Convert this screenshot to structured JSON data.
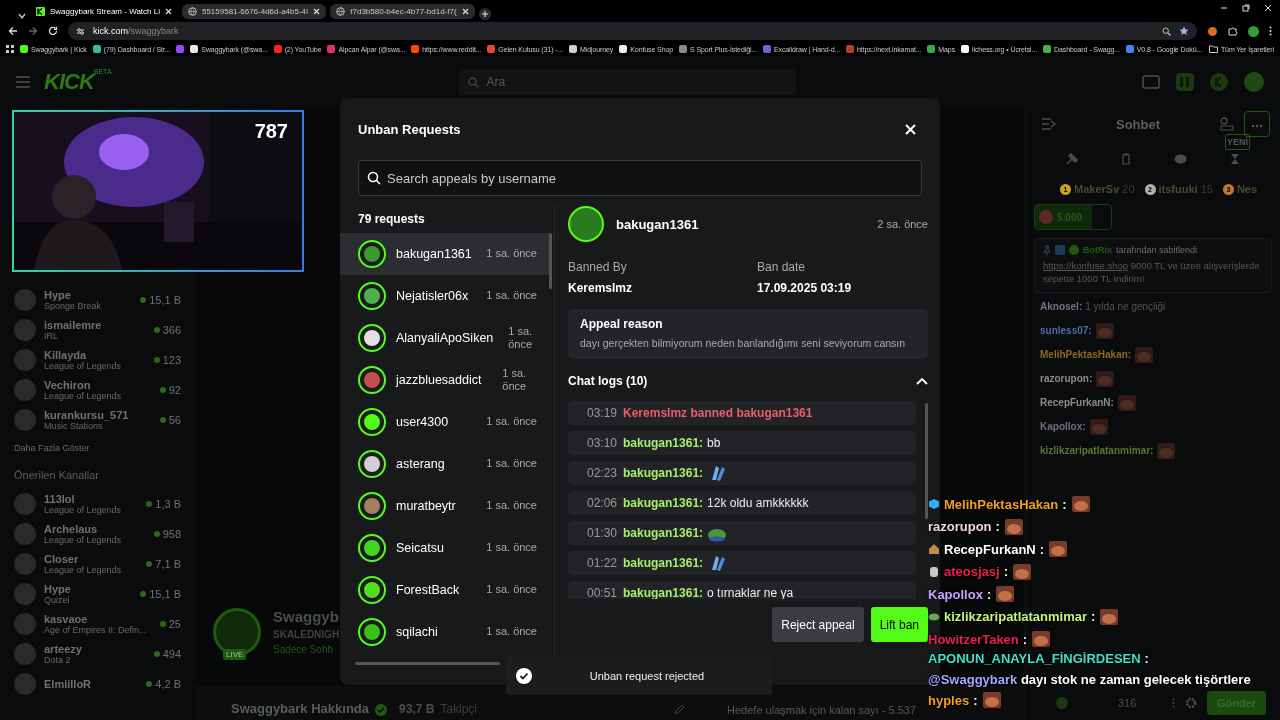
{
  "browser": {
    "tabs": [
      {
        "title": "Swaggybark Stream - Watch Li",
        "kind": "kick",
        "selected": true
      },
      {
        "title": "55159581-6676-4d6d-a4b5-4!",
        "kind": "web",
        "selected": false
      },
      {
        "title": "f7d3b580-b4ec-4b77-bd1d-f7(",
        "kind": "web",
        "selected": false
      }
    ],
    "url": {
      "host": "kick.com",
      "path": "/swaggybark"
    },
    "bookmarks": [
      {
        "label": "Swaggybark | Kick",
        "color": "#53fc18"
      },
      {
        "label": "(79) Dashboard / Str...",
        "color": "#2fbfa0"
      },
      {
        "color": "#9146ff"
      },
      {
        "label": "Swaggybark (@swa...",
        "color": "#e7e7e7"
      },
      {
        "label": "(2) YouTube",
        "color": "#ff2020"
      },
      {
        "label": "Alpcan Alpar (@swa...",
        "color": "#e1306c"
      },
      {
        "label": "https://www.reddit...",
        "color": "#ff4500"
      },
      {
        "label": "Gelen Kutusu (31) -...",
        "color": "#ea4335"
      },
      {
        "label": "Midjourney",
        "color": "#d0d0d0"
      },
      {
        "label": "Konfuse Shop",
        "color": "#f0f0f0"
      },
      {
        "label": "S Sport Plus-İstediği...",
        "color": "#8a8a8a"
      },
      {
        "label": "Excalidraw | Hand-d...",
        "color": "#6965db"
      },
      {
        "label": "https://next.inkamat...",
        "color": "#c0392b"
      },
      {
        "label": "Maps",
        "color": "#34a853"
      },
      {
        "label": "lichess.org • Ücretsi...",
        "color": "#ffffff"
      },
      {
        "label": "Dashboard - Swagg...",
        "color": "#4caf50"
      },
      {
        "label": "V0.8 - Google Dokü...",
        "color": "#4285f4"
      }
    ],
    "all_bookmarks": "Tüm Yer İşaretleri"
  },
  "header": {
    "logo": "KICK",
    "logo_tag": "BETA",
    "search_placeholder": "Ara"
  },
  "player": {
    "viewer_count": "787"
  },
  "sidebar": {
    "followed": [
      {
        "name": "Hype",
        "category": "Sponge Break",
        "viewers": "15,1 B"
      },
      {
        "name": "ismailemre",
        "category": "IRL",
        "viewers": "366"
      },
      {
        "name": "Killayda",
        "category": "League of Legends",
        "viewers": "123"
      },
      {
        "name": "Vechiron",
        "category": "League of Legends",
        "viewers": "92"
      },
      {
        "name": "kurankursu_571",
        "category": "Music Stations",
        "viewers": "56"
      }
    ],
    "show_more": "Daha Fazla Göster",
    "recommended_title": "Önerilen Kanallar",
    "recommended": [
      {
        "name": "113lol",
        "category": "League of Legends",
        "viewers": "1,3 B"
      },
      {
        "name": "Archelaus",
        "category": "League of Legends",
        "viewers": "958"
      },
      {
        "name": "Closer",
        "category": "League of Legends",
        "viewers": "7,1 B"
      },
      {
        "name": "Hype",
        "category": "Quizei",
        "viewers": "15,1 B"
      },
      {
        "name": "kasvaoe",
        "category": "Age of Empires II: Defin...",
        "viewers": "25"
      },
      {
        "name": "arteezy",
        "category": "Dota 2",
        "viewers": "494"
      },
      {
        "name": "ElmiilloR",
        "viewers": "4,2 B"
      }
    ]
  },
  "channel": {
    "name": "Swaggyb",
    "title": "SKALEDNIGH",
    "chat_mode": "Sadece Sohb",
    "live_badge": "LIVE",
    "about": "Swaggybark Hakkında",
    "followers": "93,7 B",
    "followers_label": "Takipçi",
    "goal": "Hedefe ulaşmak için kalan sayı - 5.537"
  },
  "chat": {
    "title": "Sohbet",
    "new_tag": "YENİ",
    "leaderboard": [
      {
        "rank": "1",
        "name": "MakerSv",
        "score": "20",
        "color": "#c9a227"
      },
      {
        "rank": "2",
        "name": "itsfuuki",
        "score": "15",
        "color": "#b0b0b0"
      },
      {
        "rank": "3",
        "name": "Nes",
        "color": "#c07a30"
      }
    ],
    "gift_amount": "5.000",
    "pinned": {
      "pinned_by": "BotRix",
      "pinned_label": "tarafından sabitlendi",
      "link": "https://konfuse.shop",
      "text": "9000 TL ve üzeri alışverişlerde sepette 1000 TL indirim!"
    },
    "messages": [
      {
        "user": "Aknosel:",
        "kind": "text",
        "text": "1 yılda ne gençliği",
        "color": "#7a6f8a"
      },
      {
        "user": "sunless07:",
        "kind": "emote",
        "color": "#4f6aa8"
      },
      {
        "user": "MelihPektasHakan:",
        "kind": "emote",
        "color": "#8a6a26"
      },
      {
        "user": "razorupon:",
        "kind": "emote",
        "color": "#8c8c8c"
      },
      {
        "user": "RecepFurkanN:",
        "kind": "emote",
        "color": "#8a8d90"
      },
      {
        "user": "Kapollox:",
        "kind": "emote",
        "color": "#6f6f85"
      },
      {
        "user": "kizlikzaripatlatanmimar:",
        "kind": "emote",
        "color": "#557a35"
      }
    ],
    "viewers": "316",
    "send": "Gönder"
  },
  "modal": {
    "title": "Unban Requests",
    "search_placeholder": "Search appeals by username",
    "count": "79 requests",
    "requests": [
      {
        "name": "bakugan1361",
        "time": "1 sa. önce",
        "color": "#3a9a2a",
        "selected": true
      },
      {
        "name": "Nejatisler06x",
        "time": "1 sa. önce",
        "color": "#4caf50",
        "selected": false
      },
      {
        "name": "AlanyaliApoSiken",
        "time": "1 sa. önce",
        "color": "#e0e0e0",
        "selected": false
      },
      {
        "name": "jazzbluesaddict",
        "time": "1 sa. önce",
        "color": "#c0504d",
        "selected": false
      },
      {
        "name": "user4300",
        "time": "1 sa. önce",
        "color": "#53fc18",
        "selected": false
      },
      {
        "name": "asterang",
        "time": "1 sa. önce",
        "color": "#d0d0d0",
        "selected": false
      },
      {
        "name": "muratbeytr",
        "time": "1 sa. önce",
        "color": "#a08060",
        "selected": false
      },
      {
        "name": "Seicatsu",
        "time": "1 sa. önce",
        "color": "#45d420",
        "selected": false
      },
      {
        "name": "ForestBack",
        "time": "1 sa. önce",
        "color": "#50e020",
        "selected": false
      },
      {
        "name": "sqilachi",
        "time": "1 sa. önce",
        "color": "#3cc018",
        "selected": false
      }
    ],
    "detail": {
      "user": "bakugan1361",
      "time": "2 sa. önce",
      "banned_by_label": "Banned By",
      "banned_by": "Keremslmz",
      "ban_date_label": "Ban date",
      "ban_date": "17.09.2025 03:19",
      "reason_title": "Appeal reason",
      "reason": "dayı gerçekten bilmiyorum neden banlandığımı seni seviyorum cansın",
      "logs_title": "Chat logs (10)",
      "logs_expanded": true,
      "logs": [
        {
          "time": "03:19",
          "kind": "ban",
          "text": "Keremslmz banned bakugan1361"
        },
        {
          "time": "03:10",
          "kind": "message",
          "user": "bakugan1361:",
          "text": "bb"
        },
        {
          "time": "02:23",
          "kind": "hands",
          "user": "bakugan1361:"
        },
        {
          "time": "02:06",
          "kind": "message",
          "user": "bakugan1361:",
          "text": "12k oldu amkkkkkk"
        },
        {
          "time": "01:30",
          "kind": "frog",
          "user": "bakugan1361:"
        },
        {
          "time": "01:22",
          "kind": "hands",
          "user": "bakugan1361:"
        },
        {
          "time": "00:51",
          "kind": "message",
          "user": "bakugan1361:",
          "text": "o tırnaklar ne ya"
        }
      ]
    },
    "buttons": [
      {
        "label": "Reject appeal",
        "kind": "secondary"
      },
      {
        "label": "Lift ban",
        "kind": "primary"
      }
    ]
  },
  "toast": {
    "text": "Unban request rejected"
  },
  "stream_overlay": {
    "messages": [
      {
        "user": "MelihPektasHakan",
        "separator": ":",
        "color": "#f0a020",
        "kind": "emote"
      },
      {
        "user": "razorupon",
        "separator": ":",
        "color": "#f3d6d6",
        "kind": "emote"
      },
      {
        "user": "RecepFurkanN",
        "separator": ":",
        "color": "#ffffff",
        "kind": "emote"
      },
      {
        "user": "ateosjasj",
        "separator": ":",
        "color": "#e8204a",
        "kind": "emote"
      },
      {
        "user": "Kapollox",
        "separator": ":",
        "color": "#c9a0ff",
        "kind": "emote"
      },
      {
        "user": "kizlikzaripatlatanmimar",
        "separator": ":",
        "color": "#c8f57a",
        "kind": "emote"
      },
      {
        "user": "HowitzerTaken",
        "separator": ":",
        "color": "#e8204a",
        "kind": "emote"
      },
      {
        "user": "APONUN_ANAYLA_FİNGİRDESEN",
        "separator": ":",
        "color": "#40e0c8",
        "kind": "text",
        "mention": "@Swaggybark",
        "text": "dayı stok ne zaman gelecek tişörtlere"
      },
      {
        "user": "hyples",
        "separator": ":",
        "color": "#f0a020",
        "kind": "emote"
      }
    ]
  }
}
